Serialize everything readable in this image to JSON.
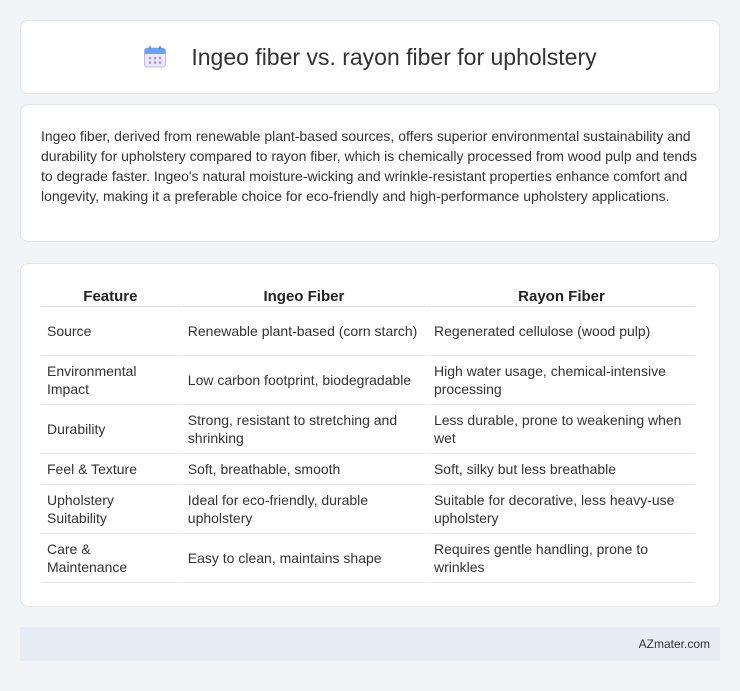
{
  "header": {
    "icon": "calendar-icon",
    "title": "Ingeo fiber vs. rayon fiber for upholstery"
  },
  "summary": {
    "text": "Ingeo fiber, derived from renewable plant-based sources, offers superior environmental sustainability and durability for upholstery compared to rayon fiber, which is chemically processed from wood pulp and tends to degrade faster. Ingeo's natural moisture-wicking and wrinkle-resistant properties enhance comfort and longevity, making it a preferable choice for eco-friendly and high-performance upholstery applications."
  },
  "table": {
    "headers": [
      "Feature",
      "Ingeo Fiber",
      "Rayon Fiber"
    ],
    "rows": [
      [
        "Source",
        "Renewable plant-based (corn starch)",
        "Regenerated cellulose (wood pulp)"
      ],
      [
        "Environmental Impact",
        "Low carbon footprint, biodegradable",
        "High water usage, chemical-intensive processing"
      ],
      [
        "Durability",
        "Strong, resistant to stretching and shrinking",
        "Less durable, prone to weakening when wet"
      ],
      [
        "Feel & Texture",
        "Soft, breathable, smooth",
        "Soft, silky but less breathable"
      ],
      [
        "Upholstery Suitability",
        "Ideal for eco-friendly, durable upholstery",
        "Suitable for decorative, less heavy-use upholstery"
      ],
      [
        "Care & Maintenance",
        "Easy to clean, maintains shape",
        "Requires gentle handling, prone to wrinkles"
      ]
    ]
  },
  "footer": {
    "text": "AZmater.com"
  },
  "colors": {
    "background": "#f3f4f7",
    "card": "#ffffff",
    "footer": "#e7ecf5",
    "icon_accent": "#a78bfa",
    "icon_header": "#60a5fa"
  }
}
